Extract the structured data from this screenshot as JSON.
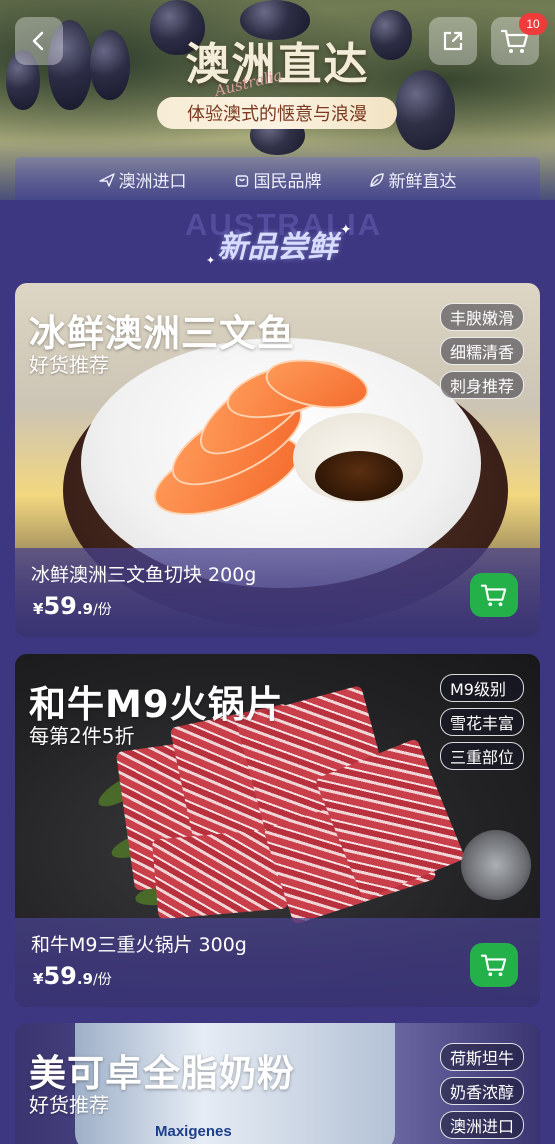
{
  "header": {
    "title": "澳洲直达",
    "script_word": "Australia",
    "subtitle": "体验澳式的惬意与浪漫",
    "cart_count": "10"
  },
  "features": [
    {
      "icon": "plane-icon",
      "label": "澳洲进口"
    },
    {
      "icon": "bag-icon",
      "label": "国民品牌"
    },
    {
      "icon": "leaf-icon",
      "label": "新鲜直达"
    }
  ],
  "section": {
    "watermark": "AUSTRALIA",
    "title": "新品尝鲜"
  },
  "products": [
    {
      "name": "冰鲜澳洲三文鱼",
      "tagline": "好货推荐",
      "tags": [
        "丰腴嫩滑",
        "细糯清香",
        "刺身推荐"
      ],
      "title": "冰鲜澳洲三文鱼切块 200g",
      "price": {
        "currency": "¥",
        "integer": "59",
        "decimal": ".9",
        "unit": "/份"
      }
    },
    {
      "name": "和牛M9火锅片",
      "tagline": "每第2件5折",
      "tags": [
        "M9级别",
        "雪花丰富",
        "三重部位"
      ],
      "title": "和牛M9三重火锅片 300g",
      "price": {
        "currency": "¥",
        "integer": "59",
        "decimal": ".9",
        "unit": "/份"
      }
    },
    {
      "name": "美可卓全脂奶粉",
      "tagline": "好货推荐",
      "tags": [
        "荷斯坦牛",
        "奶香浓醇",
        "澳洲进口"
      ],
      "brand_on_can": "Maxigenes"
    }
  ],
  "colors": {
    "background": "#3d3680",
    "cart_green": "#24b14a",
    "badge_red": "#ef3b3b"
  }
}
